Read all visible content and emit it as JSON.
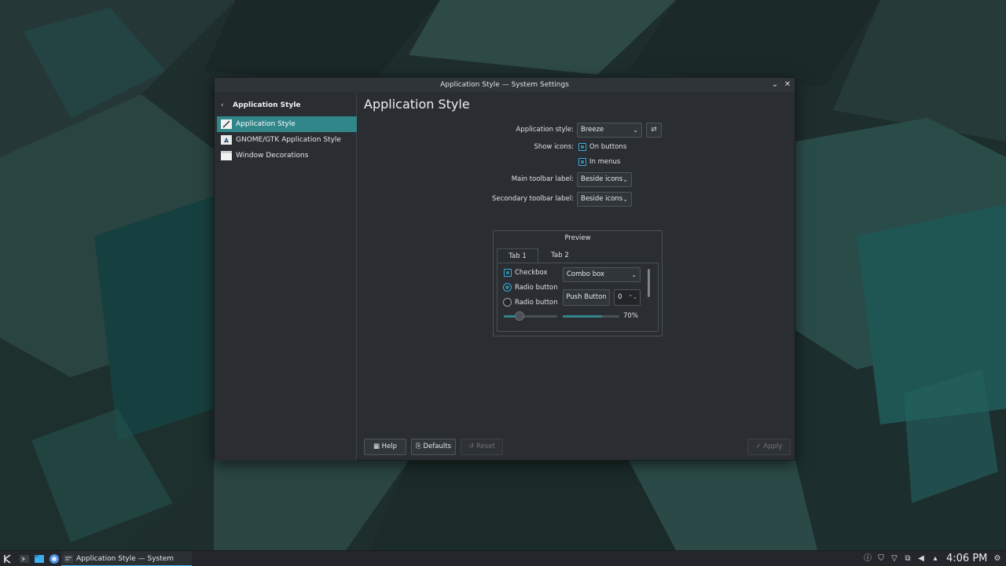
{
  "window": {
    "title": "Application Style — System Settings",
    "minimize_glyph": "⌄",
    "close_glyph": "✕"
  },
  "sidebar": {
    "back_glyph": "‹",
    "header": "Application Style",
    "items": [
      {
        "label": "Application Style",
        "icon": "brush-icon",
        "active": true
      },
      {
        "label": "GNOME/GTK Application Style",
        "icon": "gtk-icon",
        "active": false
      },
      {
        "label": "Window Decorations",
        "icon": "window-icon",
        "active": false
      }
    ]
  },
  "main": {
    "title": "Application Style",
    "app_style_label": "Application style:",
    "app_style_value": "Breeze",
    "configure_glyph": "⇄",
    "show_icons_label": "Show icons:",
    "on_buttons_label": "On buttons",
    "in_menus_label": "In menus",
    "main_toolbar_label": "Main toolbar label:",
    "main_toolbar_value": "Beside icons",
    "secondary_toolbar_label": "Secondary toolbar label:",
    "secondary_toolbar_value": "Beside icons",
    "chevron_glyph": "⌄"
  },
  "preview": {
    "title": "Preview",
    "tabs": [
      "Tab 1",
      "Tab 2"
    ],
    "checkbox_label": "Checkbox",
    "radio1_label": "Radio button",
    "radio2_label": "Radio button",
    "combo_value": "Combo box",
    "push_button_label": "Push Button",
    "spin_value": "0",
    "spin_glyph": "⌃⌄",
    "slider_value": 0.3,
    "progress_value": 0.7,
    "progress_label": "70%"
  },
  "footer": {
    "help_label": "Help",
    "defaults_label": "Defaults",
    "reset_label": "Reset",
    "apply_label": "Apply",
    "help_glyph": "▦",
    "defaults_glyph": "⎘",
    "reset_glyph": "↺",
    "apply_glyph": "✓"
  },
  "taskbar": {
    "task_label": "Application Style — System Settin...",
    "clock": "4:06 PM"
  },
  "colors": {
    "accent": "#31868a",
    "focus": "#3daee9",
    "window_bg": "#2a2e32"
  }
}
